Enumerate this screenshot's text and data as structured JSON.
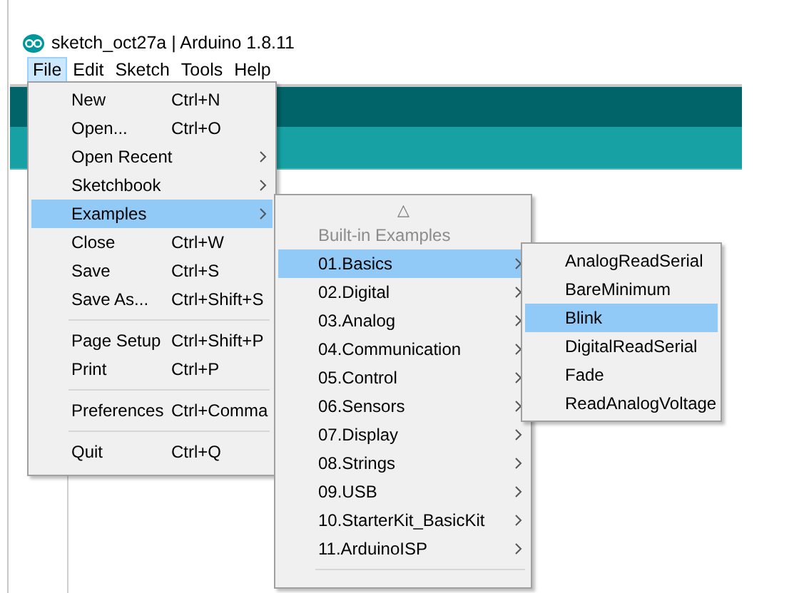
{
  "window": {
    "title": "sketch_oct27a | Arduino 1.8.11"
  },
  "menu_bar": [
    {
      "label": "File",
      "selected": true
    },
    {
      "label": "Edit",
      "selected": false
    },
    {
      "label": "Sketch",
      "selected": false
    },
    {
      "label": "Tools",
      "selected": false
    },
    {
      "label": "Help",
      "selected": false
    }
  ],
  "file_menu": {
    "items": [
      {
        "kind": "item",
        "label": "New",
        "shortcut": "Ctrl+N",
        "has_submenu": false,
        "selected": false
      },
      {
        "kind": "item",
        "label": "Open...",
        "shortcut": "Ctrl+O",
        "has_submenu": false,
        "selected": false
      },
      {
        "kind": "item",
        "label": "Open Recent",
        "has_submenu": true,
        "selected": false
      },
      {
        "kind": "item",
        "label": "Sketchbook",
        "has_submenu": true,
        "selected": false
      },
      {
        "kind": "item",
        "label": "Examples",
        "has_submenu": true,
        "selected": true
      },
      {
        "kind": "item",
        "label": "Close",
        "shortcut": "Ctrl+W",
        "has_submenu": false,
        "selected": false
      },
      {
        "kind": "item",
        "label": "Save",
        "shortcut": "Ctrl+S",
        "has_submenu": false,
        "selected": false
      },
      {
        "kind": "item",
        "label": "Save As...",
        "shortcut": "Ctrl+Shift+S",
        "has_submenu": false,
        "selected": false
      },
      {
        "kind": "separator"
      },
      {
        "kind": "item",
        "label": "Page Setup",
        "shortcut": "Ctrl+Shift+P",
        "has_submenu": false,
        "selected": false
      },
      {
        "kind": "item",
        "label": "Print",
        "shortcut": "Ctrl+P",
        "has_submenu": false,
        "selected": false
      },
      {
        "kind": "separator"
      },
      {
        "kind": "item",
        "label": "Preferences",
        "shortcut": "Ctrl+Comma",
        "has_submenu": false,
        "selected": false
      },
      {
        "kind": "separator"
      },
      {
        "kind": "item",
        "label": "Quit",
        "shortcut": "Ctrl+Q",
        "has_submenu": false,
        "selected": false
      }
    ]
  },
  "examples_menu": {
    "scroll_up": "△",
    "items": [
      {
        "kind": "header",
        "label": "Built-in Examples"
      },
      {
        "kind": "item",
        "label": "01.Basics",
        "has_submenu": true,
        "selected": true
      },
      {
        "kind": "item",
        "label": "02.Digital",
        "has_submenu": true,
        "selected": false
      },
      {
        "kind": "item",
        "label": "03.Analog",
        "has_submenu": true,
        "selected": false
      },
      {
        "kind": "item",
        "label": "04.Communication",
        "has_submenu": true,
        "selected": false
      },
      {
        "kind": "item",
        "label": "05.Control",
        "has_submenu": true,
        "selected": false
      },
      {
        "kind": "item",
        "label": "06.Sensors",
        "has_submenu": true,
        "selected": false
      },
      {
        "kind": "item",
        "label": "07.Display",
        "has_submenu": true,
        "selected": false
      },
      {
        "kind": "item",
        "label": "08.Strings",
        "has_submenu": true,
        "selected": false
      },
      {
        "kind": "item",
        "label": "09.USB",
        "has_submenu": true,
        "selected": false
      },
      {
        "kind": "item",
        "label": "10.StarterKit_BasicKit",
        "has_submenu": true,
        "selected": false
      },
      {
        "kind": "item",
        "label": "11.ArduinoISP",
        "has_submenu": true,
        "selected": false
      },
      {
        "kind": "separator"
      }
    ]
  },
  "basics_menu": {
    "items": [
      {
        "kind": "item",
        "label": "AnalogReadSerial",
        "has_submenu": false,
        "selected": false
      },
      {
        "kind": "item",
        "label": "BareMinimum",
        "has_submenu": false,
        "selected": false
      },
      {
        "kind": "item",
        "label": "Blink",
        "has_submenu": false,
        "selected": true
      },
      {
        "kind": "item",
        "label": "DigitalReadSerial",
        "has_submenu": false,
        "selected": false
      },
      {
        "kind": "item",
        "label": "Fade",
        "has_submenu": false,
        "selected": false
      },
      {
        "kind": "item",
        "label": "ReadAnalogVoltage",
        "has_submenu": false,
        "selected": false
      }
    ]
  }
}
